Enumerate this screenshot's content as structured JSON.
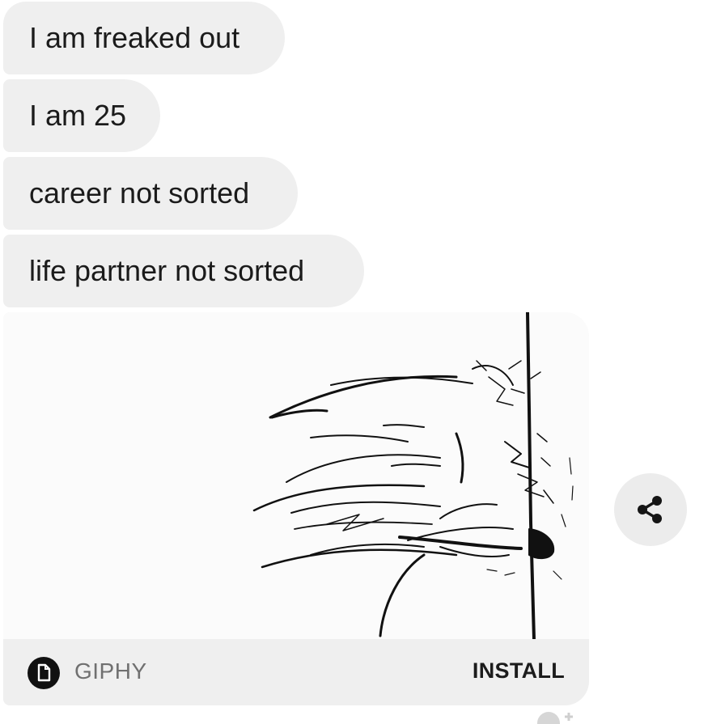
{
  "messages": [
    {
      "text": "I am freaked out"
    },
    {
      "text": "I am 25"
    },
    {
      "text": "career not sorted"
    },
    {
      "text": "life partner not sorted"
    }
  ],
  "gif": {
    "provider_label": "GIPHY",
    "install_label": "INSTALL",
    "logo_icon": "giphy-logo-icon"
  },
  "actions": {
    "share_icon": "share-icon",
    "reaction_icon": "add-reaction-icon"
  },
  "colors": {
    "bubble": "#efefef",
    "footer": "#efefef",
    "share_button": "#ececec",
    "text": "#1b1b1b",
    "muted_text": "#707070"
  }
}
